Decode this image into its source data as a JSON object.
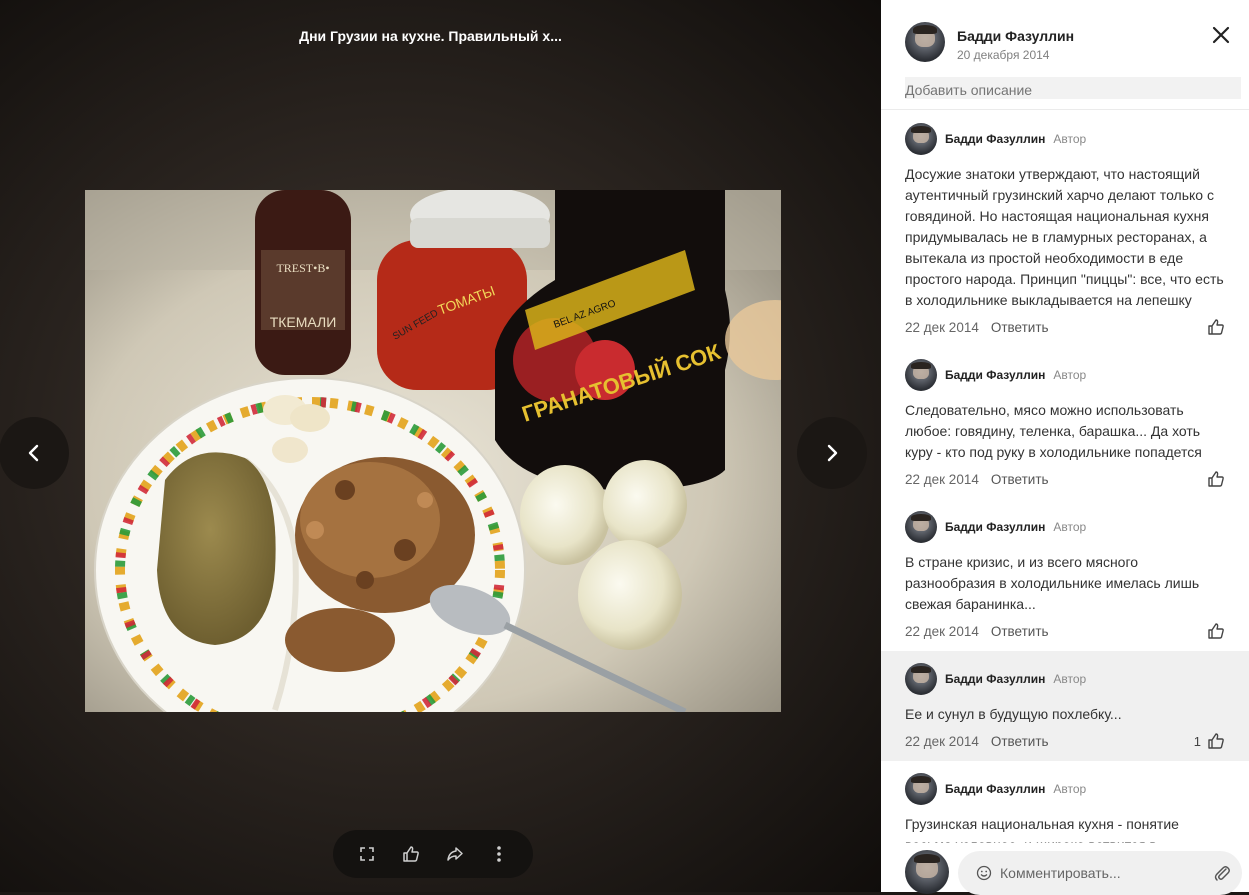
{
  "viewer": {
    "album_title": "Дни Грузии на кухне. Правильный х...",
    "photo_labels": {
      "bottle_brand": "TREST•B•",
      "bottle_name": "ТКЕМАЛИ",
      "jar_label": "ТОМАТЫ",
      "jar_brand": "SUN FEED",
      "juice_brand": "BEL AZ AGRO",
      "juice_name": "ГРАНАТОВЫЙ СОК"
    }
  },
  "panel": {
    "author": "Бадди Фазуллин",
    "date": "20 декабря 2014",
    "description_placeholder": "Добавить описание"
  },
  "comments": [
    {
      "author": "Бадди Фазуллин",
      "role": "Автор",
      "text": "Досужие знатоки утверждают, что настоящий аутентичный грузинский харчо делают только с говядиной. Но настоящая национальная кухня придумывалась не в гламурных ресторанах, а вытекала из простой необходимости в еде простого народа. Принцип \"пиццы\": все, что есть в холодильнике выкладывается на лепешку",
      "date": "22 дек 2014",
      "reply": "Ответить",
      "likes": ""
    },
    {
      "author": "Бадди Фазуллин",
      "role": "Автор",
      "text": "Следовательно, мясо можно использовать любое: говядину, теленка, барашка... Да хоть куру - кто под руку в холодильнике попадется",
      "date": "22 дек 2014",
      "reply": "Ответить",
      "likes": ""
    },
    {
      "author": "Бадди Фазуллин",
      "role": "Автор",
      "text": "В стране кризис, и из всего мясного разнообразия в холодильнике имелась лишь свежая баранинка...",
      "date": "22 дек 2014",
      "reply": "Ответить",
      "likes": ""
    },
    {
      "author": "Бадди Фазуллин",
      "role": "Автор",
      "text": "Ее и сунул в будущую похлебку...",
      "date": "22 дек 2014",
      "reply": "Ответить",
      "likes": "1"
    },
    {
      "author": "Бадди Фазуллин",
      "role": "Автор",
      "text": "Грузинская национальная кухня - понятие весьма условное, и широко ветвится в зависимости от населяющего местность народа и травы с живностью, на том месте",
      "date": "",
      "reply": "",
      "likes": ""
    }
  ],
  "compose": {
    "placeholder": "Комментировать..."
  },
  "colors": {
    "panel_bg": "#ffffff",
    "highlight_bg": "#f0f0f0",
    "viewer_bg": "#2f2823"
  },
  "icons": [
    "chevron-left-icon",
    "chevron-right-icon",
    "fullscreen-icon",
    "like-icon",
    "share-icon",
    "more-icon",
    "close-icon",
    "smile-icon",
    "paperclip-icon"
  ]
}
